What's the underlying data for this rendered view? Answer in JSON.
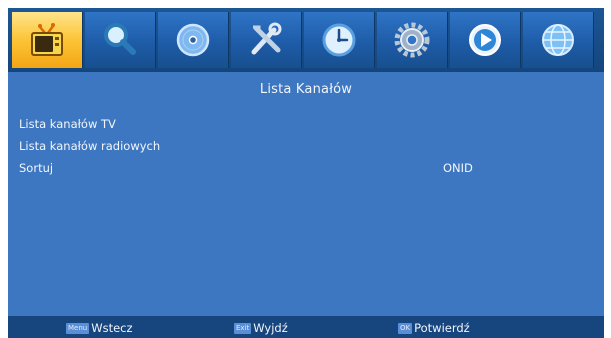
{
  "tabs": [
    {
      "icon": "tv-icon",
      "active": true
    },
    {
      "icon": "magnifier-icon",
      "active": false
    },
    {
      "icon": "disc-icon",
      "active": false
    },
    {
      "icon": "tools-icon",
      "active": false
    },
    {
      "icon": "clock-icon",
      "active": false
    },
    {
      "icon": "gear-icon",
      "active": false
    },
    {
      "icon": "play-icon",
      "active": false
    },
    {
      "icon": "globe-icon",
      "active": false
    }
  ],
  "panel": {
    "title": "Lista Kanałów",
    "items": [
      {
        "label": "Lista kanałów TV",
        "value": ""
      },
      {
        "label": "Lista kanałów radiowych",
        "value": ""
      },
      {
        "label": "Sortuj",
        "value": "ONID"
      }
    ]
  },
  "footer": {
    "hints": [
      {
        "key": "Menu",
        "label": "Wstecz"
      },
      {
        "key": "Exit",
        "label": "Wyjdź"
      },
      {
        "key": "OK",
        "label": "Potwierdź"
      }
    ]
  },
  "colors": {
    "panel_bg": "#3d76c1",
    "tab_active": "#fcc436",
    "tab_inactive": "#2f74c6",
    "footer_bg": "#17467e",
    "text": "#f2f6fb"
  }
}
